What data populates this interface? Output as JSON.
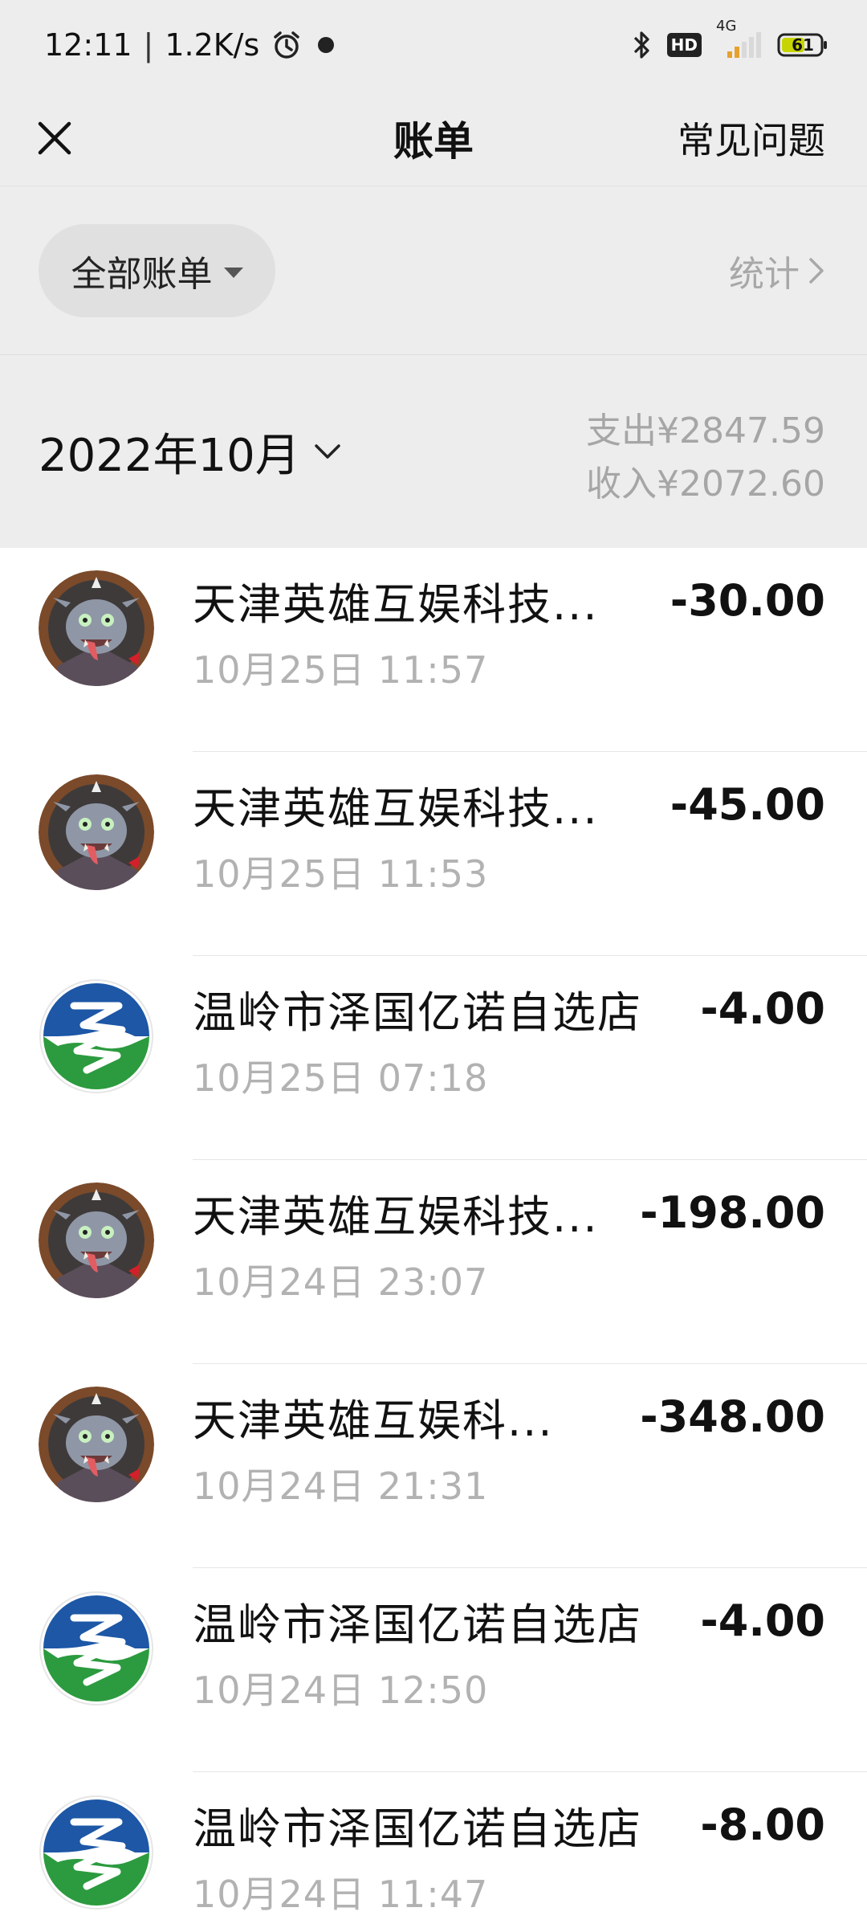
{
  "status_bar": {
    "time": "12:11",
    "speed": "1.2K/s",
    "hd": "HD",
    "net": "4G",
    "battery": "61"
  },
  "nav": {
    "title": "账单",
    "faq": "常见问题"
  },
  "filter": {
    "all_bills": "全部账单",
    "stats": "统计"
  },
  "month": {
    "label": "2022年10月",
    "expense": "支出¥2847.59",
    "income": "收入¥2072.60"
  },
  "bills": [
    {
      "merchant": "天津英雄互娱科技...",
      "time": "10月25日 11:57",
      "amount": "-30.00",
      "icon": "game-character-avatar"
    },
    {
      "merchant": "天津英雄互娱科技...",
      "time": "10月25日 11:53",
      "amount": "-45.00",
      "icon": "game-character-avatar"
    },
    {
      "merchant": "温岭市泽国亿诺自选店",
      "time": "10月25日 07:18",
      "amount": "-4.00",
      "icon": "store-logo-avatar"
    },
    {
      "merchant": "天津英雄互娱科技...",
      "time": "10月24日 23:07",
      "amount": "-198.00",
      "icon": "game-character-avatar"
    },
    {
      "merchant": "天津英雄互娱科...",
      "time": "10月24日 21:31",
      "amount": "-348.00",
      "icon": "game-character-avatar"
    },
    {
      "merchant": "温岭市泽国亿诺自选店",
      "time": "10月24日 12:50",
      "amount": "-4.00",
      "icon": "store-logo-avatar"
    },
    {
      "merchant": "温岭市泽国亿诺自选店",
      "time": "10月24日 11:47",
      "amount": "-8.00",
      "icon": "store-logo-avatar"
    }
  ]
}
